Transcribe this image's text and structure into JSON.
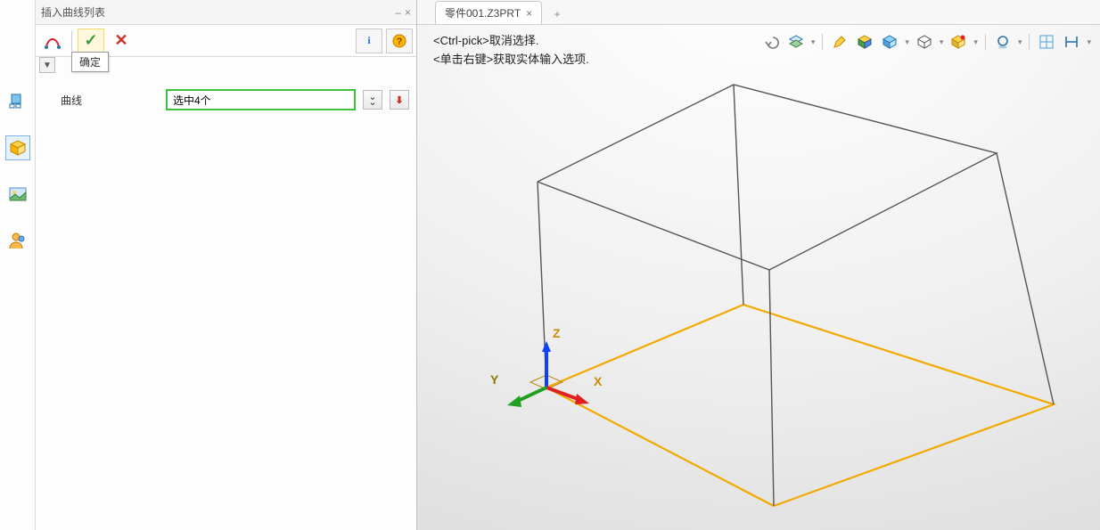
{
  "panel": {
    "title": "插入曲线列表",
    "ok_tooltip": "确定",
    "field_label": "曲线",
    "selection_value": "选中4个"
  },
  "tabs": {
    "items": [
      {
        "label": "零件001.Z3PRT"
      }
    ]
  },
  "hints": {
    "line1": "<Ctrl-pick>取消选择.",
    "line2": "<单击右键>获取实体输入选项."
  },
  "axes": {
    "x": "X",
    "y": "Y",
    "z": "Z"
  },
  "icons": {
    "check": "✓",
    "cross": "✕",
    "info": "i",
    "help": "?",
    "minimize": "–",
    "close_small": "×",
    "collapse": "▼",
    "expand_down": "⌄",
    "down_arrow": "↓",
    "plus": "+"
  }
}
